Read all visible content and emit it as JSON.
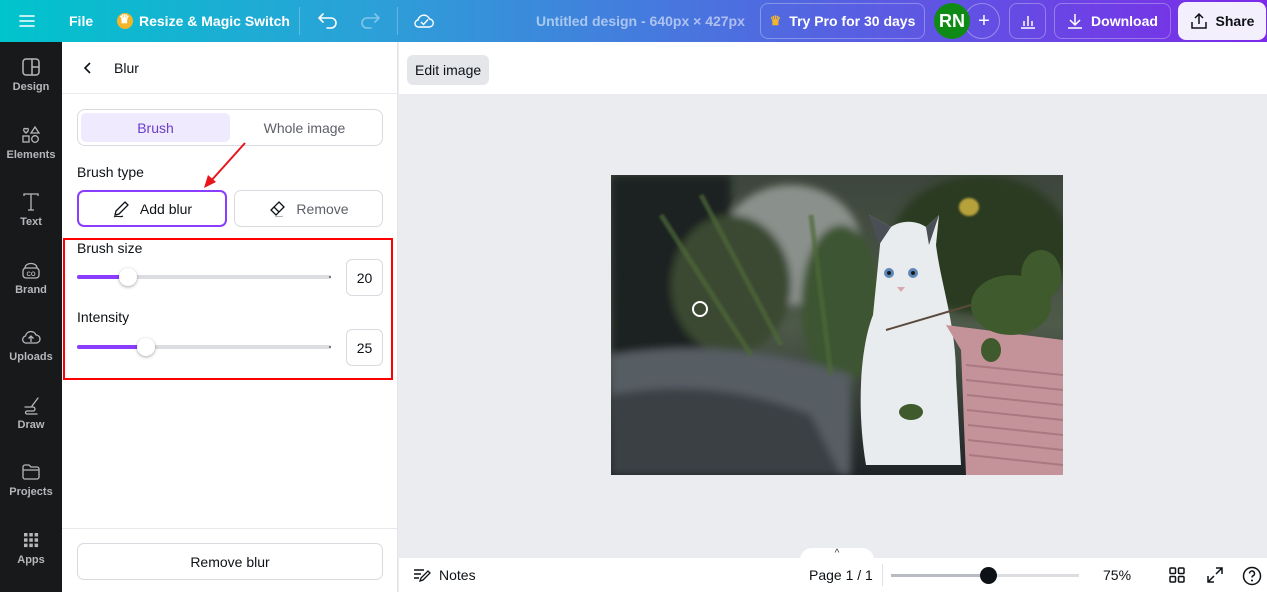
{
  "topbar": {
    "menu_icon": "hamburger-icon",
    "file_label": "File",
    "resize_label": "Resize & Magic Switch",
    "undo_icon": "undo-icon",
    "redo_icon": "redo-icon",
    "cloud_icon": "cloud-check-icon",
    "design_title": "Untitled design - 640px × 427px",
    "try_pro_label": "Try Pro for 30 days",
    "avatar_initials": "RN",
    "add_collaborator_icon": "plus-icon",
    "insights_icon": "bar-chart-icon",
    "download_label": "Download",
    "share_label": "Share"
  },
  "leftnav": {
    "items": [
      {
        "label": "Design",
        "icon": "layout-icon"
      },
      {
        "label": "Elements",
        "icon": "shapes-icon"
      },
      {
        "label": "Text",
        "icon": "text-icon"
      },
      {
        "label": "Brand",
        "icon": "brand-icon"
      },
      {
        "label": "Uploads",
        "icon": "cloud-upload-icon"
      },
      {
        "label": "Draw",
        "icon": "draw-icon"
      },
      {
        "label": "Projects",
        "icon": "folder-icon"
      },
      {
        "label": "Apps",
        "icon": "apps-grid-icon"
      }
    ]
  },
  "panel": {
    "title": "Blur",
    "mode_options": [
      "Brush",
      "Whole image"
    ],
    "active_mode": "Brush",
    "brush_type_label": "Brush type",
    "brush_types": [
      "Add blur",
      "Remove"
    ],
    "active_brush_type": "Add blur",
    "brush_size": {
      "label": "Brush size",
      "value": "20",
      "fraction": 0.2
    },
    "intensity": {
      "label": "Intensity",
      "value": "25",
      "fraction": 0.27
    },
    "remove_blur_label": "Remove blur"
  },
  "editbar": {
    "edit_image_label": "Edit image"
  },
  "canvas": {
    "image_description": "White kitten sitting on a stone ledge beside a pink planter with greenery"
  },
  "bottombar": {
    "notes_label": "Notes",
    "page_info": "Page 1 / 1",
    "zoom_value": "75%",
    "zoom_fraction": 0.52
  },
  "colors": {
    "accent": "#8b3dff",
    "annotation_red": "#ff0000",
    "avatar_green": "#0f8a15"
  }
}
